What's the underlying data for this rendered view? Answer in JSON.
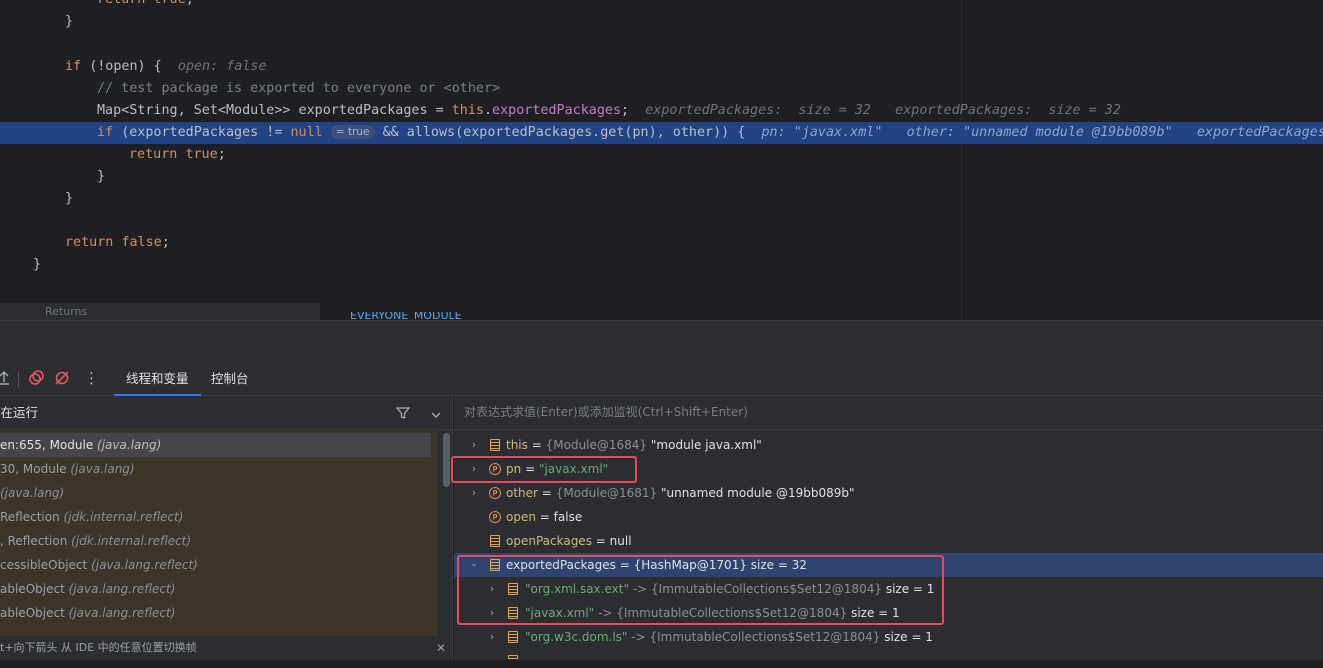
{
  "editor": {
    "lines": {
      "l1_kw": "return",
      "l1_val": "true",
      "l2": "}",
      "l4_kw": "if",
      "l4_code": "(!open) {",
      "l4_hint": "open: false",
      "l5_comment": "// test package is exported to everyone or <other>",
      "l6_code": "Map<String, Set<Module>> exportedPackages = ",
      "l6_this": "this",
      "l6_field": "exportedPackages",
      "l6_semi": ";",
      "l6_hint1": "exportedPackages:  size = 32",
      "l6_hint2": "exportedPackages:  size = 32",
      "l7_kw": "if",
      "l7_code": "(exportedPackages != ",
      "l7_null": "null",
      "l7_badge": "= true",
      "l7_code2": "&& allows(exportedPackages.get(pn), other)) {",
      "l7_hint1": "pn: \"javax.xml\"",
      "l7_hint2": "other: \"unnamed module @19bb089b\"",
      "l7_hint3": "exportedPackages",
      "l8_kw": "return",
      "l8_val": "true",
      "l8_semi": ";",
      "l9": "}",
      "l10": "}",
      "l12_kw": "return",
      "l12_val": "false",
      "l12_semi": ";",
      "l13": "}"
    },
    "strip_text": "Returns",
    "strip_text2": "EVERYONE_MODULE"
  },
  "debugger": {
    "tabs": {
      "threads_vars": "线程和变量",
      "console": "控制台"
    },
    "frames_title": "正在运行",
    "frames": [
      {
        "method": "en:655, Module",
        "pkg": "(java.lang)"
      },
      {
        "method": "30, Module",
        "pkg": "(java.lang)"
      },
      {
        "method": "",
        "pkg": "(java.lang)"
      },
      {
        "method": "Reflection",
        "pkg": "(jdk.internal.reflect)"
      },
      {
        "method": ", Reflection",
        "pkg": "(jdk.internal.reflect)"
      },
      {
        "method": "cessibleObject",
        "pkg": "(java.lang.reflect)"
      },
      {
        "method": "ableObject",
        "pkg": "(java.lang.reflect)"
      },
      {
        "method": "ableObject",
        "pkg": "(java.lang.reflect)"
      }
    ],
    "frames_footer": "t+向下箭头 从 IDE 中的任意位置切换帧",
    "eval_placeholder": "对表达式求值(Enter)或添加监视(Ctrl+Shift+Enter)",
    "variables": [
      {
        "name": "this",
        "type": "{Module@1684}",
        "value": "\"module java.xml\""
      },
      {
        "name": "pn",
        "value": "\"javax.xml\""
      },
      {
        "name": "other",
        "type": "{Module@1681}",
        "value": "\"unnamed module @19bb089b\""
      },
      {
        "name": "open",
        "value": "false"
      },
      {
        "name": "openPackages",
        "value": "null"
      },
      {
        "name": "exportedPackages",
        "type": "{HashMap@1701}",
        "value": "size = 32"
      },
      {
        "key": "\"org.xml.sax.ext\"",
        "arrow": "->",
        "type": "{ImmutableCollections$Set12@1804}",
        "value": "size = 1"
      },
      {
        "key": "\"javax.xml\"",
        "arrow": "->",
        "type": "{ImmutableCollections$Set12@1804}",
        "value": "size = 1"
      },
      {
        "key": "\"org.w3c.dom.ls\"",
        "arrow": "->",
        "type": "{ImmutableCollections$Set12@1804}",
        "value": "size = 1"
      }
    ]
  }
}
